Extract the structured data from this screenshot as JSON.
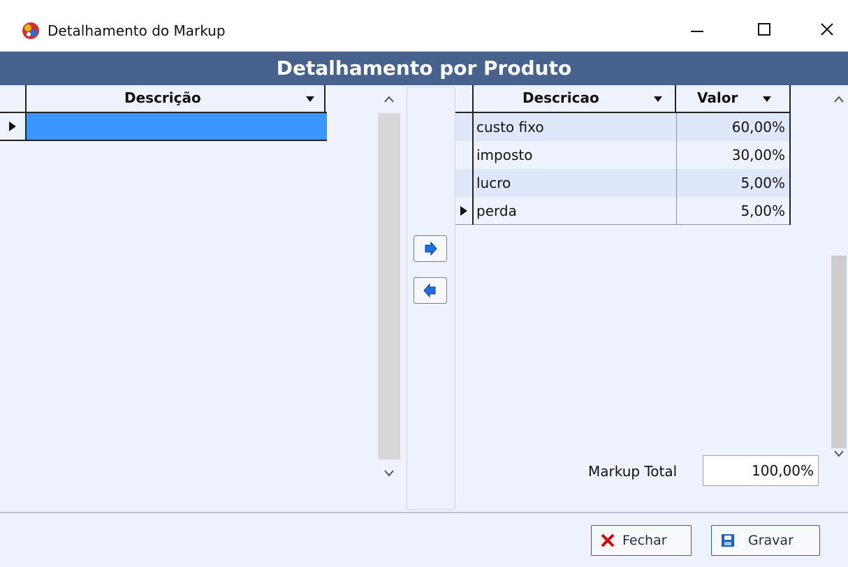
{
  "window": {
    "title": "Detalhamento do Markup"
  },
  "header": {
    "title": "Detalhamento por Produto"
  },
  "left_grid": {
    "column": "Descrição"
  },
  "right_grid": {
    "columns": [
      "Descricao",
      "Valor"
    ],
    "rows": [
      {
        "descricao": "custo fixo",
        "valor": "60,00%"
      },
      {
        "descricao": "imposto",
        "valor": "30,00%"
      },
      {
        "descricao": "lucro",
        "valor": "5,00%"
      },
      {
        "descricao": "perda",
        "valor": "5,00%"
      }
    ]
  },
  "markup_total": {
    "label": "Markup Total",
    "value": "100,00%"
  },
  "buttons": {
    "fechar": "Fechar",
    "gravar": "Gravar"
  },
  "icons": {
    "app": "app-icon",
    "arrow_right": "arrow-right-icon",
    "arrow_left": "arrow-left-icon",
    "close": "close-icon",
    "minimize": "minimize-icon",
    "maximize": "maximize-icon",
    "fechar": "x-icon",
    "gravar": "save-icon"
  },
  "colors": {
    "header_band": "#47628d",
    "selection": "#3b96ff",
    "row_alt": "#dfe8fb",
    "button_border": "#2f5fa6"
  }
}
